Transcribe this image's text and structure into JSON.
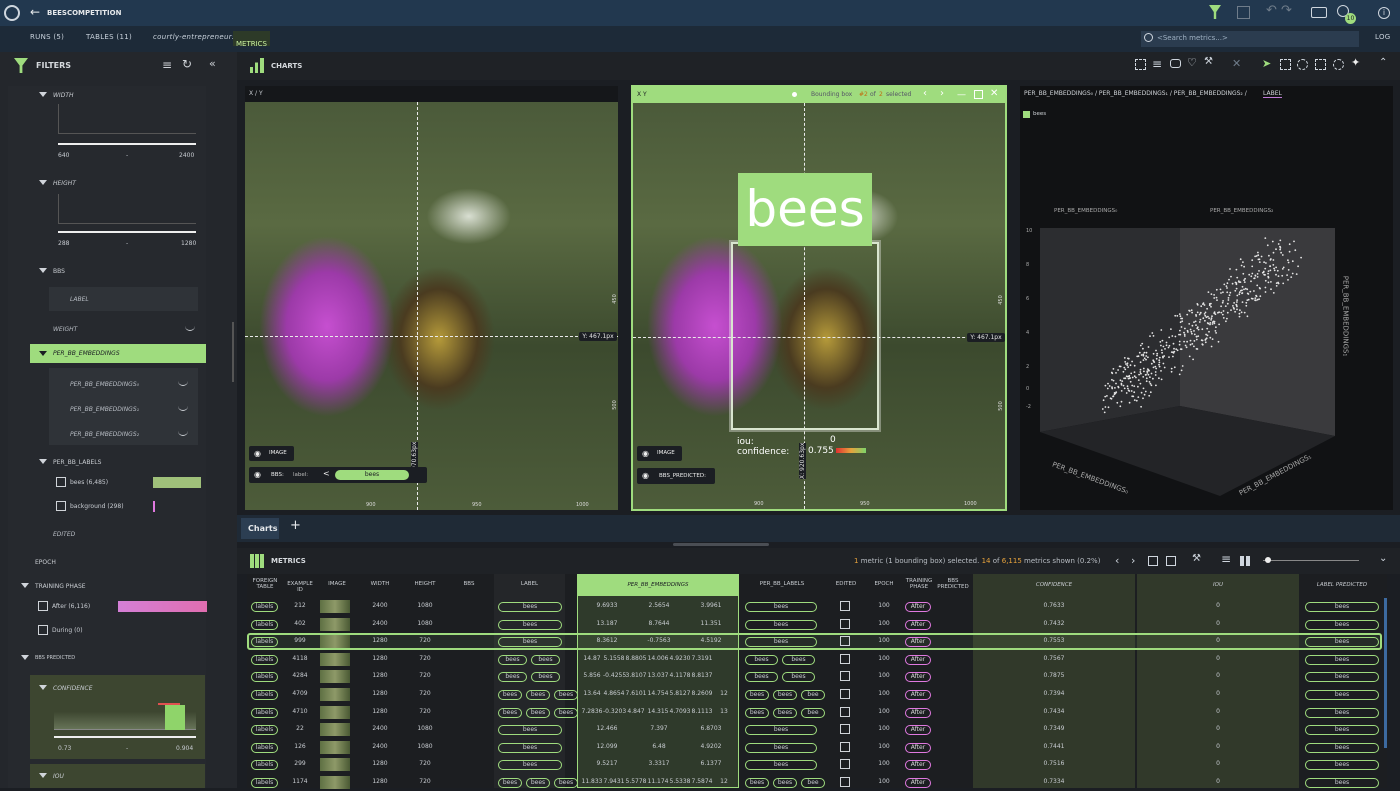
{
  "app": {
    "project_title": "BEESCOMPETITION",
    "badge_count": "10"
  },
  "tabs": {
    "runs": "RUNS (5)",
    "tables": "TABLES (11)",
    "entity": "courtly-entrepreneur:",
    "metrics": "METRICS",
    "search_placeholder": "<Search metrics...>",
    "log": "LOG"
  },
  "filters": {
    "title": "FILTERS",
    "width": {
      "label": "WIDTH",
      "min": "640",
      "max": "2400"
    },
    "height": {
      "label": "HEIGHT",
      "min": "288",
      "max": "1280"
    },
    "bbs": {
      "label": "BBS",
      "sub_label": "LABEL",
      "sub_weight": "WEIGHT"
    },
    "per_bb_embeddings": {
      "label": "PER_BB_EMBEDDINGS",
      "items": [
        "PER_BB_EMBEDDINGS₀",
        "PER_BB_EMBEDDINGS₁",
        "PER_BB_EMBEDDINGS₂"
      ]
    },
    "per_bb_labels": {
      "label": "PER_BB_LABELS",
      "items": [
        {
          "label": "bees (6,485)"
        },
        {
          "label": "background (298)"
        }
      ]
    },
    "edited": "EDITED",
    "epoch": "EPOCH",
    "training_phase": {
      "label": "TRAINING PHASE",
      "items": [
        {
          "label": "After (6,116)"
        },
        {
          "label": "During (0)"
        }
      ]
    },
    "bbs_predicted": "BBS PREDICTED",
    "confidence": {
      "label": "CONFIDENCE",
      "min": "0.73",
      "max": "0.904"
    },
    "iou": "IOU"
  },
  "charts": {
    "title": "CHARTS",
    "panel1": {
      "header": "X / Y",
      "y_marker": "Y: 467.1px",
      "x_marker": "X: 970.63px",
      "x_ticks": [
        "900",
        "950",
        "1000"
      ],
      "y_ticks": [
        "450",
        "500"
      ],
      "image_label": "IMAGE",
      "bbs_label": "BBS:",
      "label_prefix": "label:",
      "bees": "bees"
    },
    "panel2": {
      "header": "X  Y",
      "bbox_prefix": "Bounding box",
      "bbox_index": "#2",
      "bbox_of": "of",
      "bbox_total": "2",
      "bbox_suffix": "selected",
      "big_label": "bees",
      "iou_label": "iou:",
      "iou_value": "0",
      "confidence_label": "confidence:",
      "confidence_value": "0.755",
      "y_marker": "Y: 467.1px",
      "x_marker": "X: 920.63px",
      "x_ticks": [
        "900",
        "950",
        "1000"
      ],
      "y_ticks": [
        "450",
        "500"
      ],
      "image_label": "IMAGE",
      "bbs_pred_label": "BBS_PREDICTED:"
    },
    "panel3": {
      "header_axes": "PER_BB_EMBEDDINGS₀ / PER_BB_EMBEDDINGS₁ / PER_BB_EMBEDDINGS₂ /",
      "header_color": "LABEL",
      "legend": "bees",
      "axis_top_left": "PER_BB_EMBEDDINGS₀",
      "axis_top_right": "PER_BB_EMBEDDINGS₂",
      "axis_right": "PER_BB_EMBEDDINGS₁",
      "axis_bottom_left": "PER_BB_EMBEDDINGS₀",
      "axis_bottom_right": "PER_BB_EMBEDDINGS₁",
      "z_ticks": [
        "10",
        "8",
        "6",
        "4",
        "2",
        "0",
        "-2"
      ]
    }
  },
  "charts_tab": {
    "label": "Charts",
    "add": "+"
  },
  "metrics": {
    "title": "METRICS",
    "status_count": "1",
    "status_middle": "metric (1 bounding box) selected.",
    "status_shown": "14",
    "status_of": "of",
    "status_total": "6,115",
    "status_tail": "metrics shown (0.2%)",
    "columns": [
      "FOREIGN TABLE",
      "EXAMPLE ID",
      "IMAGE",
      "WIDTH",
      "HEIGHT",
      "BBS",
      "LABEL",
      "PER_BB_EMBEDDINGS",
      "PER_BB_LABELS",
      "EDITED",
      "EPOCH",
      "TRAINING PHASE",
      "BBS PREDICTED",
      "CONFIDENCE",
      "IOU",
      "LABEL PREDICTED"
    ],
    "rows": [
      {
        "table": "labels",
        "id": "212",
        "width": "2400",
        "height": "1080",
        "label": [
          "bees"
        ],
        "emb": [
          "9.6933",
          "2.5654",
          "3.9961"
        ],
        "per_bb_labels": [
          "bees"
        ],
        "epoch": "100",
        "phase": "After",
        "confidence": "0.7633",
        "iou": "0",
        "label_pred": "bees"
      },
      {
        "table": "labels",
        "id": "402",
        "width": "2400",
        "height": "1080",
        "label": [
          "bees"
        ],
        "emb": [
          "13.187",
          "8.7644",
          "11.351"
        ],
        "per_bb_labels": [
          "bees"
        ],
        "epoch": "100",
        "phase": "After",
        "confidence": "0.7432",
        "iou": "0",
        "label_pred": "bees"
      },
      {
        "table": "labels",
        "id": "999",
        "width": "1280",
        "height": "720",
        "label": [
          "bees"
        ],
        "emb": [
          "8.3612",
          "-0.7563",
          "4.5192"
        ],
        "per_bb_labels": [
          "bees"
        ],
        "epoch": "100",
        "phase": "After",
        "confidence": "0.7553",
        "iou": "0",
        "label_pred": "bees"
      },
      {
        "table": "labels",
        "id": "4118",
        "width": "1280",
        "height": "720",
        "label": [
          "bees",
          "bees"
        ],
        "emb": [
          "14.87",
          "5.1558",
          "8.8805",
          "14.006",
          "4.9230",
          "7.3191"
        ],
        "per_bb_labels": [
          "bees",
          "bees"
        ],
        "epoch": "100",
        "phase": "After",
        "confidence": "0.7567",
        "iou": "0",
        "label_pred": "bees"
      },
      {
        "table": "labels",
        "id": "4284",
        "width": "1280",
        "height": "720",
        "label": [
          "bees",
          "bees"
        ],
        "emb": [
          "5.856",
          "-0.4255",
          "3.8107",
          "13.037",
          "4.1178",
          "8.8137"
        ],
        "per_bb_labels": [
          "bees",
          "bees"
        ],
        "epoch": "100",
        "phase": "After",
        "confidence": "0.7875",
        "iou": "0",
        "label_pred": "bees"
      },
      {
        "table": "labels",
        "id": "4709",
        "width": "1280",
        "height": "720",
        "label": [
          "bees",
          "bees",
          "bees"
        ],
        "emb": [
          "13.64",
          "4.8654",
          "7.6101",
          "14.754",
          "5.8127",
          "8.2609",
          "12"
        ],
        "per_bb_labels": [
          "bees",
          "bees",
          "bee"
        ],
        "epoch": "100",
        "phase": "After",
        "confidence": "0.7394",
        "iou": "0",
        "label_pred": "bees"
      },
      {
        "table": "labels",
        "id": "4710",
        "width": "1280",
        "height": "720",
        "label": [
          "bees",
          "bees",
          "bees"
        ],
        "emb": [
          "7.2836",
          "-0.3203",
          "4.847",
          "14.315",
          "4.7093",
          "8.1113",
          "13"
        ],
        "per_bb_labels": [
          "bees",
          "bees",
          "bee"
        ],
        "epoch": "100",
        "phase": "After",
        "confidence": "0.7434",
        "iou": "0",
        "label_pred": "bees"
      },
      {
        "table": "labels",
        "id": "22",
        "width": "2400",
        "height": "1080",
        "label": [
          "bees"
        ],
        "emb": [
          "12.466",
          "7.397",
          "6.8703"
        ],
        "per_bb_labels": [
          "bees"
        ],
        "epoch": "100",
        "phase": "After",
        "confidence": "0.7349",
        "iou": "0",
        "label_pred": "bees"
      },
      {
        "table": "labels",
        "id": "126",
        "width": "2400",
        "height": "1080",
        "label": [
          "bees"
        ],
        "emb": [
          "12.099",
          "6.48",
          "4.9202"
        ],
        "per_bb_labels": [
          "bees"
        ],
        "epoch": "100",
        "phase": "After",
        "confidence": "0.7441",
        "iou": "0",
        "label_pred": "bees"
      },
      {
        "table": "labels",
        "id": "299",
        "width": "1280",
        "height": "720",
        "label": [
          "bees"
        ],
        "emb": [
          "9.5217",
          "3.3317",
          "6.1377"
        ],
        "per_bb_labels": [
          "bees"
        ],
        "epoch": "100",
        "phase": "After",
        "confidence": "0.7516",
        "iou": "0",
        "label_pred": "bees"
      },
      {
        "table": "labels",
        "id": "1174",
        "width": "1280",
        "height": "720",
        "label": [
          "bees",
          "bees",
          "bees"
        ],
        "emb": [
          "11.833",
          "7.9431",
          "5.5778",
          "11.174",
          "5.5338",
          "7.5874",
          "12"
        ],
        "per_bb_labels": [
          "bees",
          "bees",
          "bee"
        ],
        "epoch": "100",
        "phase": "After",
        "confidence": "0.7334",
        "iou": "0",
        "label_pred": "bees"
      }
    ]
  },
  "colors": {
    "accent_green": "#9fdc7e",
    "pink": "#e079e0",
    "topbar": "#22384f",
    "orange": "#e6a23c"
  }
}
